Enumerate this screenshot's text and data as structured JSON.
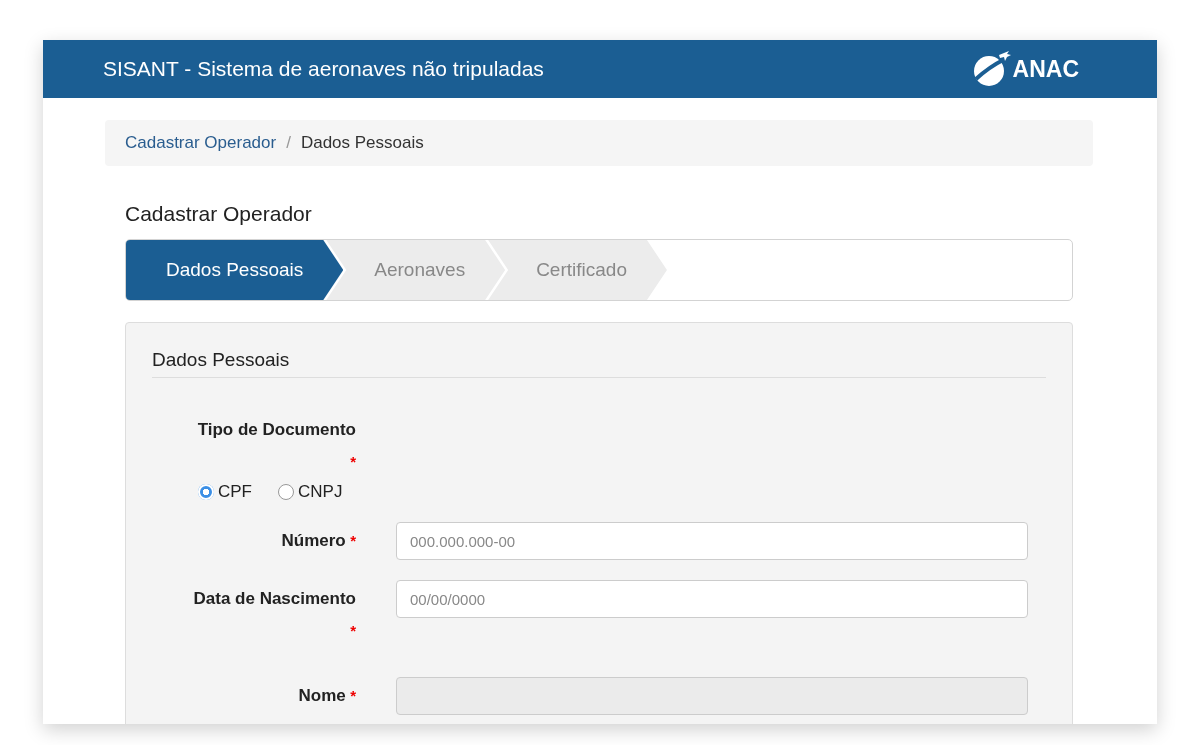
{
  "header": {
    "title": "SISANT - Sistema de aeronaves não tripuladas",
    "logo_text": "ANAC"
  },
  "breadcrumb": [
    {
      "label": "Cadastrar Operador",
      "link": true
    },
    {
      "label": "Dados Pessoais",
      "link": false
    }
  ],
  "breadcrumb_separator": "/",
  "page_title": "Cadastrar Operador",
  "steps": [
    {
      "label": "Dados Pessoais",
      "selected": true
    },
    {
      "label": "Aeronaves",
      "selected": false
    },
    {
      "label": "Certificado",
      "selected": false
    }
  ],
  "panel": {
    "title": "Dados Pessoais",
    "fields": [
      {
        "kind": "radio",
        "label": "Tipo de Documento",
        "marker": "*",
        "options": [
          {
            "label": "CPF",
            "selected": true
          },
          {
            "label": "CNPJ",
            "selected": false
          }
        ]
      },
      {
        "kind": "text",
        "label": "Número",
        "marker": "*",
        "placeholder": "000.000.000-00",
        "disabled": false
      },
      {
        "kind": "text",
        "label": "Data de Nascimento",
        "marker": "*",
        "placeholder": "00/00/0000",
        "disabled": false
      },
      {
        "kind": "text",
        "label": "Nome",
        "marker": "*",
        "disabled": true
      }
    ]
  }
}
